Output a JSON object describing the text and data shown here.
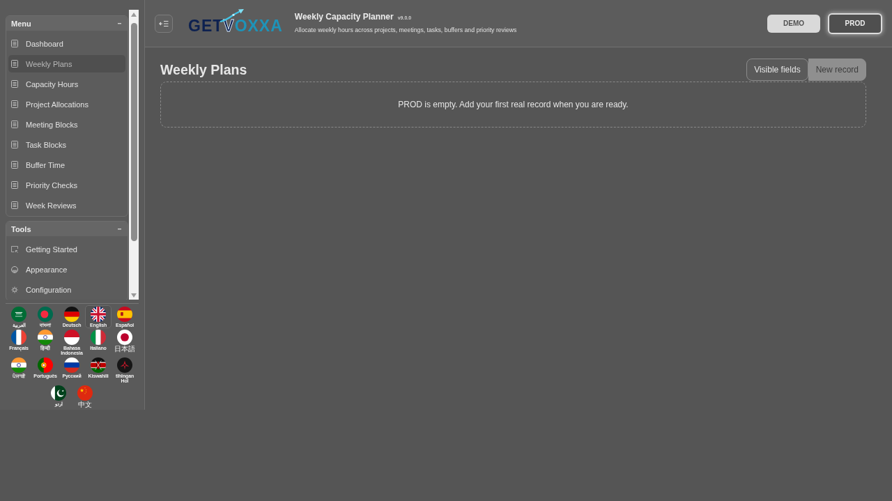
{
  "sidebar": {
    "sections": [
      {
        "title": "Menu",
        "expanded": true,
        "items": [
          {
            "label": "Dashboard",
            "kind": "document",
            "selected": false
          },
          {
            "label": "Weekly Plans",
            "kind": "document",
            "selected": true
          },
          {
            "label": "Capacity Hours",
            "kind": "document",
            "selected": false
          },
          {
            "label": "Project Allocations",
            "kind": "document",
            "selected": false
          },
          {
            "label": "Meeting Blocks",
            "kind": "document",
            "selected": false
          },
          {
            "label": "Task Blocks",
            "kind": "document",
            "selected": false
          },
          {
            "label": "Buffer Time",
            "kind": "document",
            "selected": false
          },
          {
            "label": "Priority Checks",
            "kind": "document",
            "selected": false
          },
          {
            "label": "Week Reviews",
            "kind": "document",
            "selected": false
          }
        ]
      },
      {
        "title": "Tools",
        "expanded": true,
        "items": [
          {
            "label": "Getting Started",
            "kind": "window",
            "selected": false
          },
          {
            "label": "Appearance",
            "kind": "contrast",
            "selected": false
          },
          {
            "label": "Configuration",
            "kind": "gear",
            "selected": false
          }
        ]
      }
    ],
    "languages": [
      {
        "label": "العربية",
        "kind": "saudi",
        "selected": false
      },
      {
        "label": "বাংলা",
        "kind": "bangladesh",
        "selected": false
      },
      {
        "label": "Deutsch",
        "kind": "germany",
        "selected": false
      },
      {
        "label": "English",
        "kind": "uk",
        "selected": true
      },
      {
        "label": "Español",
        "kind": "spain",
        "selected": false
      },
      {
        "label": "Français",
        "kind": "france",
        "selected": false
      },
      {
        "label": "हिन्दी",
        "kind": "india",
        "selected": false
      },
      {
        "label": "Bahasa Indonesia",
        "kind": "indonesia",
        "selected": false
      },
      {
        "label": "Italiano",
        "kind": "italy",
        "selected": false
      },
      {
        "label": "日本語",
        "kind": "japan",
        "selected": false
      },
      {
        "label": "ਪੰਜਾਬੀ",
        "kind": "india",
        "selected": false
      },
      {
        "label": "Português",
        "kind": "portugal",
        "selected": false
      },
      {
        "label": "Русский",
        "kind": "russia",
        "selected": false
      },
      {
        "label": "Kiswahili",
        "kind": "kenya",
        "selected": false
      },
      {
        "label": "tlhIngan Hol",
        "kind": "emblem",
        "selected": false
      },
      {
        "label": "اردو",
        "kind": "pakistan",
        "selected": false
      },
      {
        "label": "中文",
        "kind": "china",
        "selected": false
      }
    ]
  },
  "header": {
    "logo": [
      "GET",
      "V",
      "OXXA"
    ],
    "title": "Weekly Capacity Planner",
    "version": "v9.0.0",
    "subtitle": "Allocate weekly hours across projects, meetings, tasks, buffers and priority reviews",
    "environments": [
      {
        "label": "DEMO",
        "selected": false
      },
      {
        "label": "PROD",
        "selected": true
      }
    ]
  },
  "page": {
    "title": "Weekly Plans",
    "actions": [
      {
        "label": "Visible fields",
        "kind": "secondary"
      },
      {
        "label": "New record",
        "kind": "primary"
      }
    ],
    "empty_message": "PROD is empty. Add your first real record when you are ready."
  }
}
